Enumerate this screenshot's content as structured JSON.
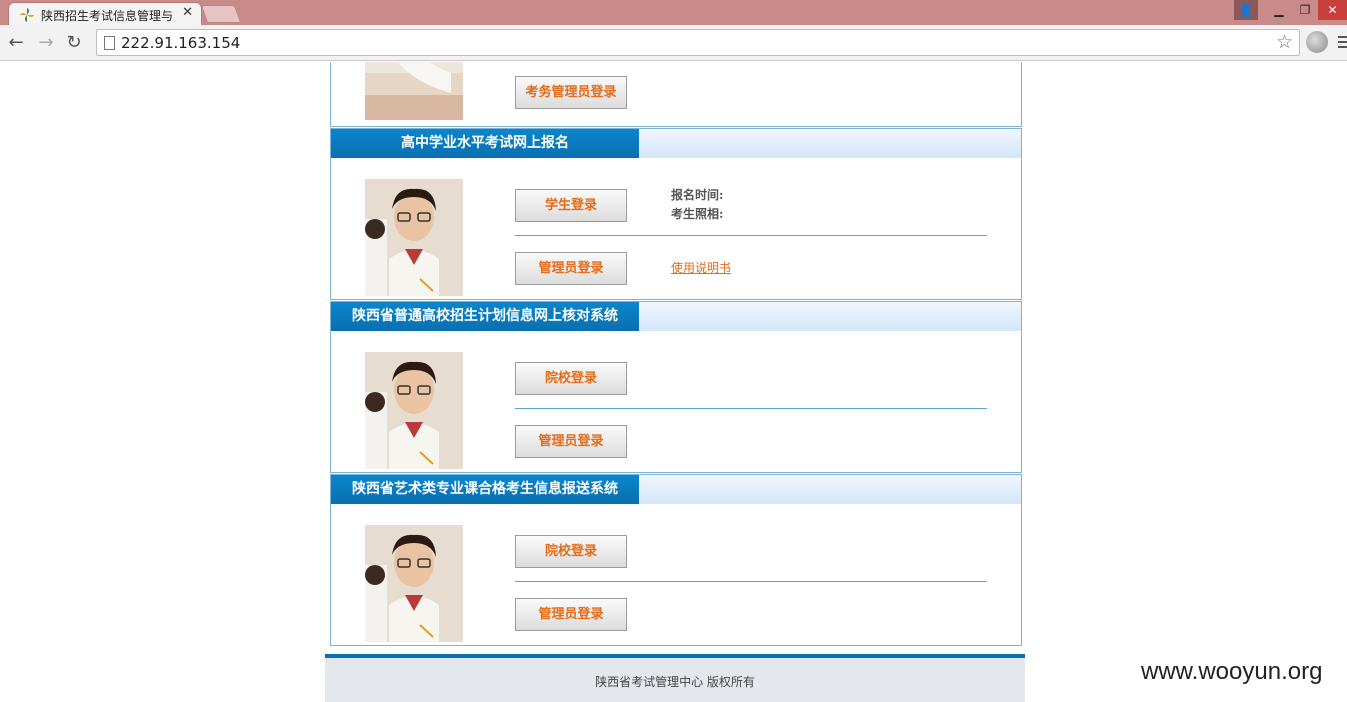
{
  "browser": {
    "tab_title": "陕西招生考试信息管理与",
    "url": "222.91.163.154"
  },
  "top_panel": {
    "button": "考务管理员登录"
  },
  "panels": [
    {
      "title": "高中学业水平考试网上报名",
      "button1": "学生登录",
      "button2": "管理员登录",
      "info_line1": "报名时间:",
      "info_line2": "考生照相:",
      "link": "使用说明书"
    },
    {
      "title": "陕西省普通高校招生计划信息网上核对系统",
      "button1": "院校登录",
      "button2": "管理员登录"
    },
    {
      "title": "陕西省艺术类专业课合格考生信息报送系统",
      "button1": "院校登录",
      "button2": "管理员登录"
    }
  ],
  "footer": {
    "text": "陕西省考试管理中心  版权所有"
  },
  "watermark": "www.wooyun.org"
}
